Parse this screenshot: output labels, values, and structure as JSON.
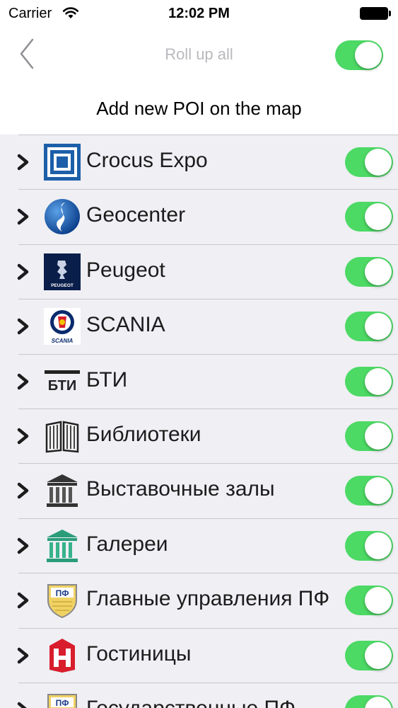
{
  "status_bar": {
    "carrier": "Carrier",
    "time": "12:02 PM"
  },
  "nav": {
    "title": "Roll up all",
    "roll_up_all_on": true
  },
  "add_poi_label": "Add new POI on the map",
  "poi_list": [
    {
      "label": "Crocus Expo",
      "icon": "crocus-expo-logo-icon",
      "enabled": true
    },
    {
      "label": "Geocenter",
      "icon": "geocenter-logo-icon",
      "enabled": true
    },
    {
      "label": "Peugeot",
      "icon": "peugeot-logo-icon",
      "enabled": true
    },
    {
      "label": "SCANIA",
      "icon": "scania-logo-icon",
      "enabled": true
    },
    {
      "label": "БТИ",
      "icon": "bti-logo-icon",
      "enabled": true
    },
    {
      "label": "Библиотеки",
      "icon": "book-icon",
      "enabled": true
    },
    {
      "label": "Выставочные залы",
      "icon": "museum-icon",
      "enabled": true
    },
    {
      "label": "Галереи",
      "icon": "gallery-icon",
      "enabled": true
    },
    {
      "label": "Главные управления ПФ",
      "icon": "pf-shield-icon",
      "enabled": true
    },
    {
      "label": "Гостиницы",
      "icon": "hotel-icon",
      "enabled": true
    },
    {
      "label": "Государственные ПФ",
      "icon": "pf-shield-icon",
      "enabled": true
    }
  ],
  "colors": {
    "switch_on": "#4cd964",
    "list_background": "#efeff4",
    "separator": "#c8c7cc"
  },
  "logo_text": {
    "peugeot": "PEUGEOT",
    "scania": "SCANIA",
    "bti": "БТИ",
    "pf": "ПФ"
  }
}
